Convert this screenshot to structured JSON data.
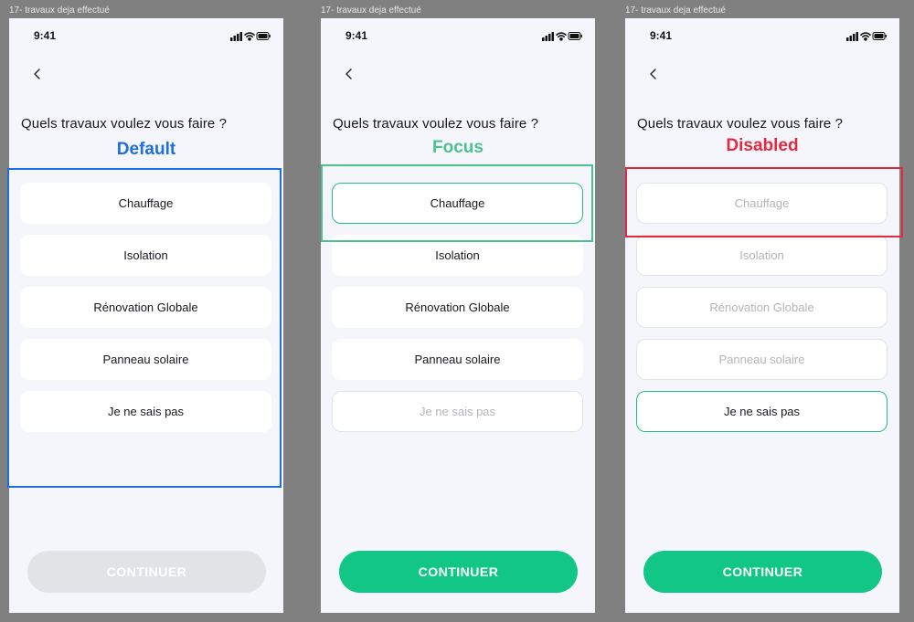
{
  "frame_title": "17- travaux deja effectué",
  "status_time": "9:41",
  "question": "Quels travaux voulez vous faire ?",
  "options": [
    "Chauffage",
    "Isolation",
    "Rénovation Globale",
    "Panneau solaire",
    "Je ne sais pas"
  ],
  "continue_label": "CONTINUER",
  "states": {
    "default": {
      "label": "Default",
      "color": "#1d6fe0"
    },
    "focus": {
      "label": "Focus",
      "color": "#4cc08e"
    },
    "disabled": {
      "label": "Disabled",
      "color": "#e3293f"
    }
  },
  "colors": {
    "primary_green": "#12c786",
    "button_disabled": "#e1e3e6",
    "button_disabled_text": "#ffffff"
  },
  "icons": [
    "back-chevron-icon",
    "cellular-signal-icon",
    "wifi-icon",
    "battery-icon"
  ]
}
